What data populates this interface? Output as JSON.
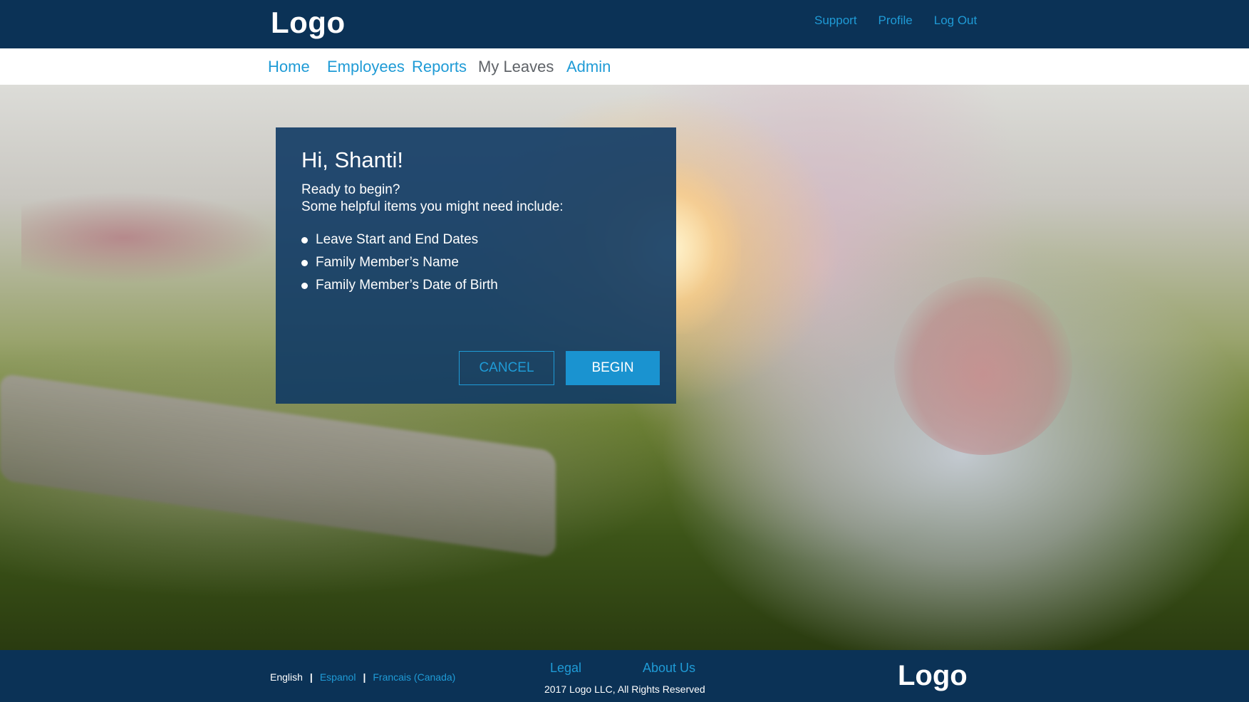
{
  "header": {
    "logo": "Logo",
    "links": [
      "Support",
      "Profile",
      "Log Out"
    ]
  },
  "nav": {
    "items": [
      {
        "label": "Home",
        "active": false
      },
      {
        "label": "Employees",
        "active": false
      },
      {
        "label": "Reports",
        "active": false
      },
      {
        "label": "My Leaves",
        "active": true
      },
      {
        "label": "Admin",
        "active": false
      }
    ]
  },
  "modal": {
    "title": "Hi, Shanti!",
    "intro_line1": "Ready to begin?",
    "intro_line2": "Some helpful items you might need include:",
    "items": [
      "Leave Start and End Dates",
      "Family Member’s Name",
      "Family Member’s Date of Birth"
    ],
    "cancel_label": "CANCEL",
    "begin_label": "BEGIN"
  },
  "footer": {
    "languages": [
      {
        "label": "English",
        "current": true
      },
      {
        "label": "Espanol",
        "current": false
      },
      {
        "label": "Francais (Canada)",
        "current": false
      }
    ],
    "language_separator": "|",
    "legal": "Legal",
    "about": "About Us",
    "copyright": "2017 Logo LLC, All Rights Reserved",
    "logo": "Logo"
  },
  "colors": {
    "brand_navy": "#0b3256",
    "accent_blue": "#1f9bd6",
    "nav_active": "#5f6368"
  }
}
